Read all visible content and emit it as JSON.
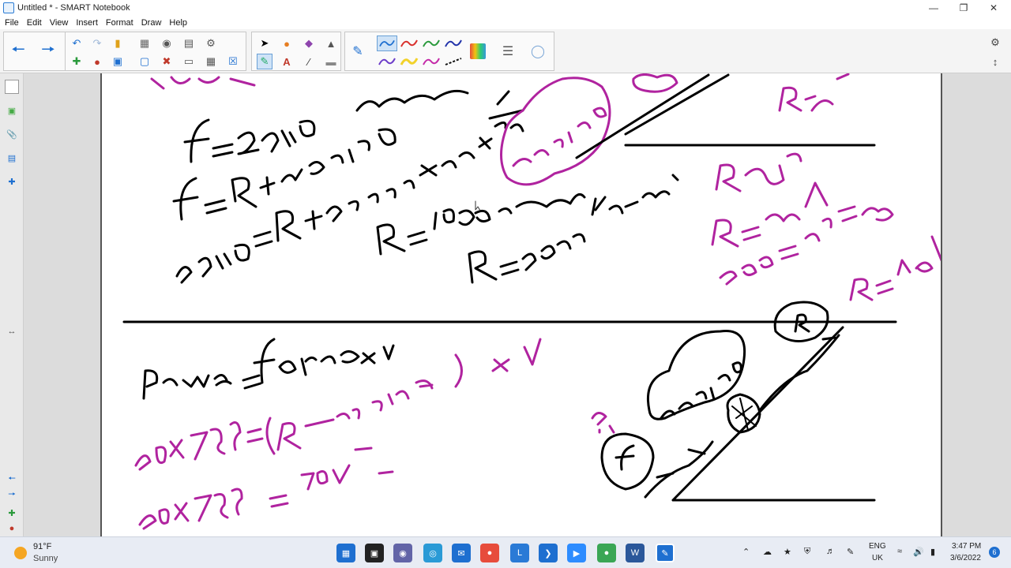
{
  "window": {
    "title": "Untitled * - SMART Notebook"
  },
  "menu": [
    "File",
    "Edit",
    "View",
    "Insert",
    "Format",
    "Draw",
    "Help"
  ],
  "weather": {
    "temp": "91°F",
    "condition": "Sunny"
  },
  "clock": {
    "time": "3:47 PM",
    "date": "3/6/2022"
  },
  "lang": {
    "code": "ENG",
    "region": "UK"
  },
  "notification_count": "6",
  "colors": {
    "magenta": "#b0239f",
    "ink": "#000000",
    "accent": "#1e6fd0"
  },
  "icons": [
    "back-icon",
    "forward-icon",
    "undo-icon",
    "redo-icon",
    "open-icon",
    "save-icon",
    "screen-shade-icon",
    "paste-icon",
    "delete-icon",
    "table-icon",
    "select-icon",
    "pen-icon",
    "text-icon",
    "eraser-icon",
    "line-icon",
    "color-palette-icon",
    "settings-icon"
  ]
}
